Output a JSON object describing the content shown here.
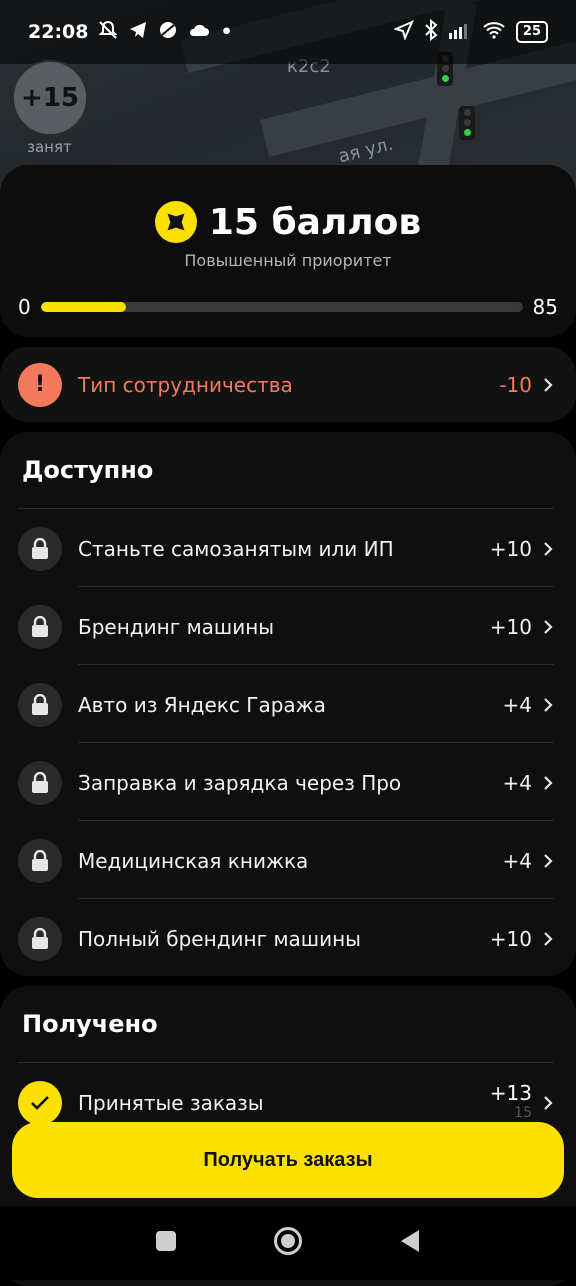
{
  "status_bar": {
    "time": "22:08",
    "dot": "•",
    "battery": "25",
    "icons_left": [
      "bell-off-icon",
      "telegram-icon",
      "browser-icon",
      "cloud-icon"
    ],
    "icons_right": [
      "location-icon",
      "bluetooth-icon",
      "signal-icon",
      "wifi-icon",
      "battery-icon"
    ]
  },
  "map": {
    "house_number": "к2с2",
    "street": "ая ул."
  },
  "bubble": {
    "value": "+15",
    "label": "занят"
  },
  "score": {
    "value": "15 баллов",
    "subtitle": "Повышенный приоритет",
    "min": "0",
    "max": "85",
    "progress": 15,
    "progress_max": 85,
    "accent": "#fce000"
  },
  "warning": {
    "icon": "!",
    "label": "Тип сотрудничества",
    "value": "-10",
    "color": "#f47a5e"
  },
  "available": {
    "title": "Доступно",
    "items": [
      {
        "label": "Станьте самозанятым или ИП",
        "value": "+10"
      },
      {
        "label": "Брендинг машины",
        "value": "+10"
      },
      {
        "label": "Авто из Яндекс Гаража",
        "value": "+4"
      },
      {
        "label": "Заправка и зарядка через Про",
        "value": "+4"
      },
      {
        "label": "Медицинская книжка",
        "value": "+4"
      },
      {
        "label": "Полный брендинг машины",
        "value": "+10"
      }
    ]
  },
  "received": {
    "title": "Получено",
    "items": [
      {
        "label": "Принятые заказы",
        "value": "+13",
        "sub": "15"
      }
    ]
  },
  "cta": {
    "label": "Получать заказы"
  }
}
